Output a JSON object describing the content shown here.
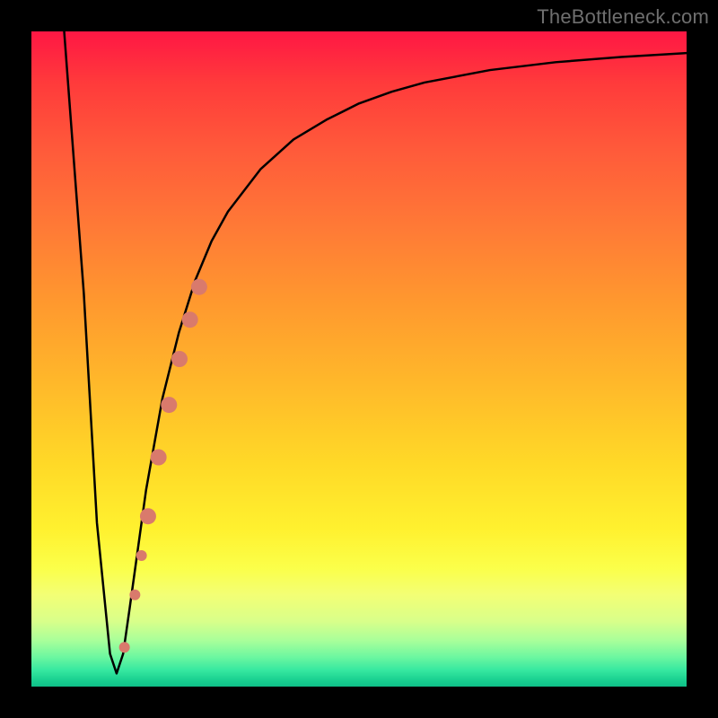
{
  "watermark": "TheBottleneck.com",
  "chart_data": {
    "type": "line",
    "title": "",
    "xlabel": "",
    "ylabel": "",
    "xlim": [
      0,
      100
    ],
    "ylim": [
      0,
      100
    ],
    "grid": false,
    "legend": false,
    "background_gradient": {
      "direction": "vertical",
      "stops": [
        {
          "pos": 0,
          "color": "#ff1744"
        },
        {
          "pos": 50,
          "color": "#ffcc29"
        },
        {
          "pos": 84,
          "color": "#fbff4a"
        },
        {
          "pos": 100,
          "color": "#0fbf88"
        }
      ]
    },
    "series": [
      {
        "name": "bottleneck-curve",
        "color": "#000000",
        "stroke_width": 2.5,
        "x": [
          5,
          8,
          10,
          12,
          13,
          14,
          15,
          17.5,
          20,
          22.5,
          25,
          27.5,
          30,
          35,
          40,
          45,
          50,
          55,
          60,
          70,
          80,
          90,
          100
        ],
        "y": [
          100,
          60,
          25,
          5,
          2,
          5,
          12,
          30,
          44,
          54,
          62,
          68,
          72.5,
          79,
          83.5,
          86.5,
          89,
          90.8,
          92.2,
          94.1,
          95.3,
          96.1,
          96.7
        ]
      }
    ],
    "markers": {
      "name": "highlight-dots",
      "color": "#d97a6c",
      "points": [
        {
          "x": 14.2,
          "y": 6,
          "r": 6
        },
        {
          "x": 15.8,
          "y": 14,
          "r": 6
        },
        {
          "x": 16.8,
          "y": 20,
          "r": 6
        },
        {
          "x": 17.8,
          "y": 26,
          "r": 9
        },
        {
          "x": 19.4,
          "y": 35,
          "r": 9
        },
        {
          "x": 21.0,
          "y": 43,
          "r": 9
        },
        {
          "x": 22.6,
          "y": 50,
          "r": 9
        },
        {
          "x": 24.2,
          "y": 56,
          "r": 9
        },
        {
          "x": 25.6,
          "y": 61,
          "r": 9
        }
      ]
    }
  }
}
